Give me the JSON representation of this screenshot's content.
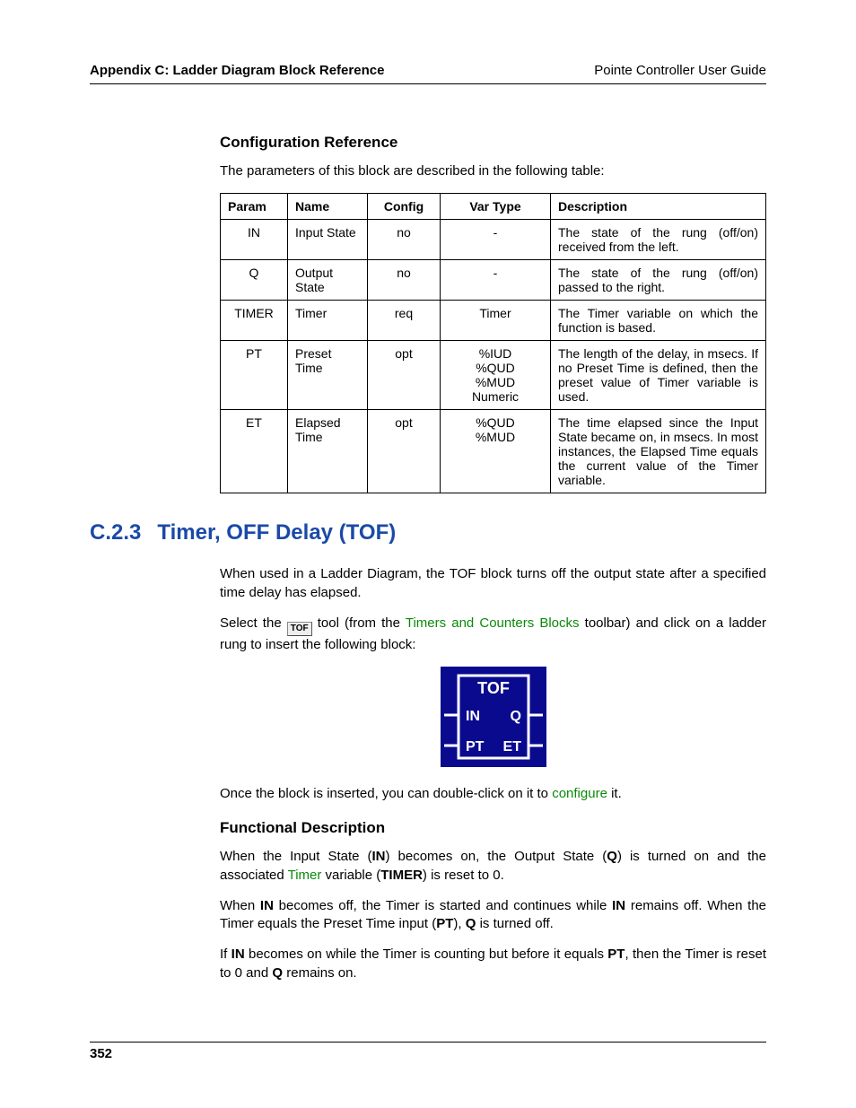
{
  "header": {
    "left": "Appendix C: Ladder Diagram Block Reference",
    "right": "Pointe Controller User Guide"
  },
  "config_ref": {
    "heading": "Configuration Reference",
    "intro": "The parameters of this block are described in the following table:",
    "columns": {
      "param": "Param",
      "name": "Name",
      "config": "Config",
      "vartype": "Var Type",
      "desc": "Description"
    },
    "rows": [
      {
        "param": "IN",
        "name": "Input State",
        "config": "no",
        "vartype": "-",
        "desc": "The state of the rung (off/on) received from the left."
      },
      {
        "param": "Q",
        "name": "Output State",
        "config": "no",
        "vartype": "-",
        "desc": "The state of the rung (off/on) passed to the right."
      },
      {
        "param": "TIMER",
        "name": "Timer",
        "config": "req",
        "vartype": "Timer",
        "desc": "The Timer variable on which the function is based."
      },
      {
        "param": "PT",
        "name": "Preset Time",
        "config": "opt",
        "vartype": "%IUD\n%QUD\n%MUD\nNumeric",
        "desc": "The length of the delay, in msecs. If no Preset Time is defined, then the preset value of Timer variable is used."
      },
      {
        "param": "ET",
        "name": "Elapsed Time",
        "config": "opt",
        "vartype": "%QUD\n%MUD",
        "desc": "The time elapsed since the Input State became on, in msecs. In most instances, the Elapsed Time equals the current value of the Timer variable."
      }
    ]
  },
  "section": {
    "number": "C.2.3",
    "title": "Timer, OFF Delay (TOF)",
    "intro": "When used in a Ladder Diagram, the TOF block turns off the output state after a specified time delay has elapsed.",
    "select_pre": "Select the ",
    "tool_icon_label": "TOF",
    "select_mid": " tool (from the ",
    "select_link": "Timers and Counters Blocks",
    "select_post": " toolbar) and click on a ladder rung to insert the following block:",
    "block_labels": {
      "title": "TOF",
      "in": "IN",
      "q": "Q",
      "pt": "PT",
      "et": "ET"
    },
    "after_block_pre": "Once the block is inserted, you can double-click on it to ",
    "after_block_link": "configure",
    "after_block_post": " it."
  },
  "func_desc": {
    "heading": "Functional Description",
    "p1_pre": "When the Input State (",
    "p1_in": "IN",
    "p1_mid1": ") becomes on, the Output State (",
    "p1_q": "Q",
    "p1_mid2": ") is turned on and the associated ",
    "p1_timer_link": "Timer",
    "p1_mid3": " variable (",
    "p1_timer_bold": "TIMER",
    "p1_post": ") is reset to 0.",
    "p2_pre": "When ",
    "p2_in": "IN",
    "p2_mid1": " becomes off, the Timer is started and continues while ",
    "p2_in2": "IN",
    "p2_mid2": " remains off. When the Timer equals the Preset Time input (",
    "p2_pt": "PT",
    "p2_mid3": "), ",
    "p2_q": "Q",
    "p2_post": " is turned off.",
    "p3_pre": "If ",
    "p3_in": "IN",
    "p3_mid1": " becomes on while the Timer is counting but before it equals ",
    "p3_pt": "PT",
    "p3_mid2": ", then the Timer is reset to 0 and ",
    "p3_q": "Q",
    "p3_post": " remains on."
  },
  "page_number": "352"
}
